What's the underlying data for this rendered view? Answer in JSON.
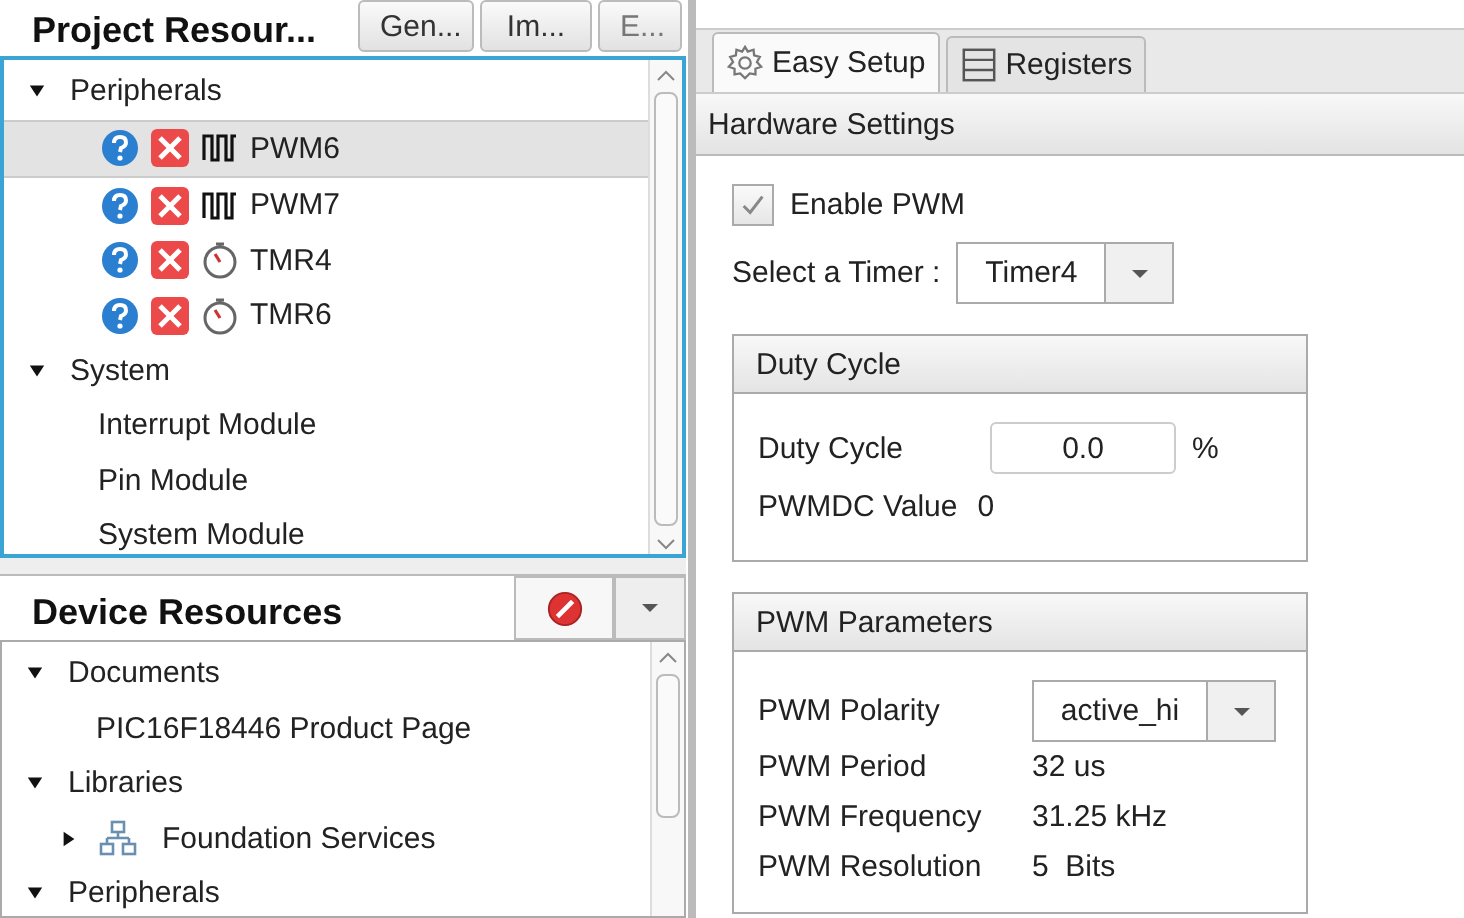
{
  "project_resources": {
    "title": "Project Resour...",
    "buttons": [
      "Gen...",
      "Im...",
      "E..."
    ],
    "tree": [
      {
        "label": "Peripherals",
        "expanded": true,
        "children": [
          {
            "label": "PWM6",
            "kind": "pwm",
            "selected": true
          },
          {
            "label": "PWM7",
            "kind": "pwm",
            "selected": false
          },
          {
            "label": "TMR4",
            "kind": "timer",
            "selected": false
          },
          {
            "label": "TMR6",
            "kind": "timer",
            "selected": false
          }
        ]
      },
      {
        "label": "System",
        "expanded": true,
        "children": [
          {
            "label": "Interrupt Module",
            "kind": "plain",
            "selected": false
          },
          {
            "label": "Pin Module",
            "kind": "plain",
            "selected": false
          },
          {
            "label": "System Module",
            "kind": "plain",
            "selected": false
          }
        ]
      }
    ]
  },
  "device_resources": {
    "title": "Device Resources",
    "tree": [
      {
        "label": "Documents",
        "expanded": true,
        "children": [
          {
            "label": "PIC16F18446 Product Page",
            "kind": "plain",
            "selected": false
          }
        ]
      },
      {
        "label": "Libraries",
        "expanded": true,
        "children": [
          {
            "label": "Foundation Services",
            "kind": "library",
            "expanded": false,
            "selected": false
          }
        ]
      },
      {
        "label": "Peripherals",
        "expanded": true
      }
    ]
  },
  "tabs": [
    {
      "label": "Easy Setup",
      "kind": "gear",
      "selected": true
    },
    {
      "label": "Registers",
      "kind": "list",
      "selected": false
    }
  ],
  "section_title": "Hardware Settings",
  "enable_pwm": {
    "label": "Enable PWM",
    "checked": true
  },
  "timer_select": {
    "label": "Select a Timer :",
    "value": "Timer4"
  },
  "duty_cycle": {
    "title": "Duty Cycle",
    "field_label": "Duty Cycle",
    "value": "0.0",
    "unit": "%",
    "pwmdc_label": "PWMDC Value",
    "pwmdc_value": "0"
  },
  "pwm_parameters": {
    "title": "PWM Parameters",
    "polarity_label": "PWM Polarity",
    "polarity_value": "active_hi",
    "rows": [
      {
        "label": "PWM Period",
        "value": "32 us"
      },
      {
        "label": "PWM Frequency",
        "value": "31.25 kHz"
      },
      {
        "label": "PWM Resolution",
        "value": "5  Bits"
      }
    ]
  }
}
